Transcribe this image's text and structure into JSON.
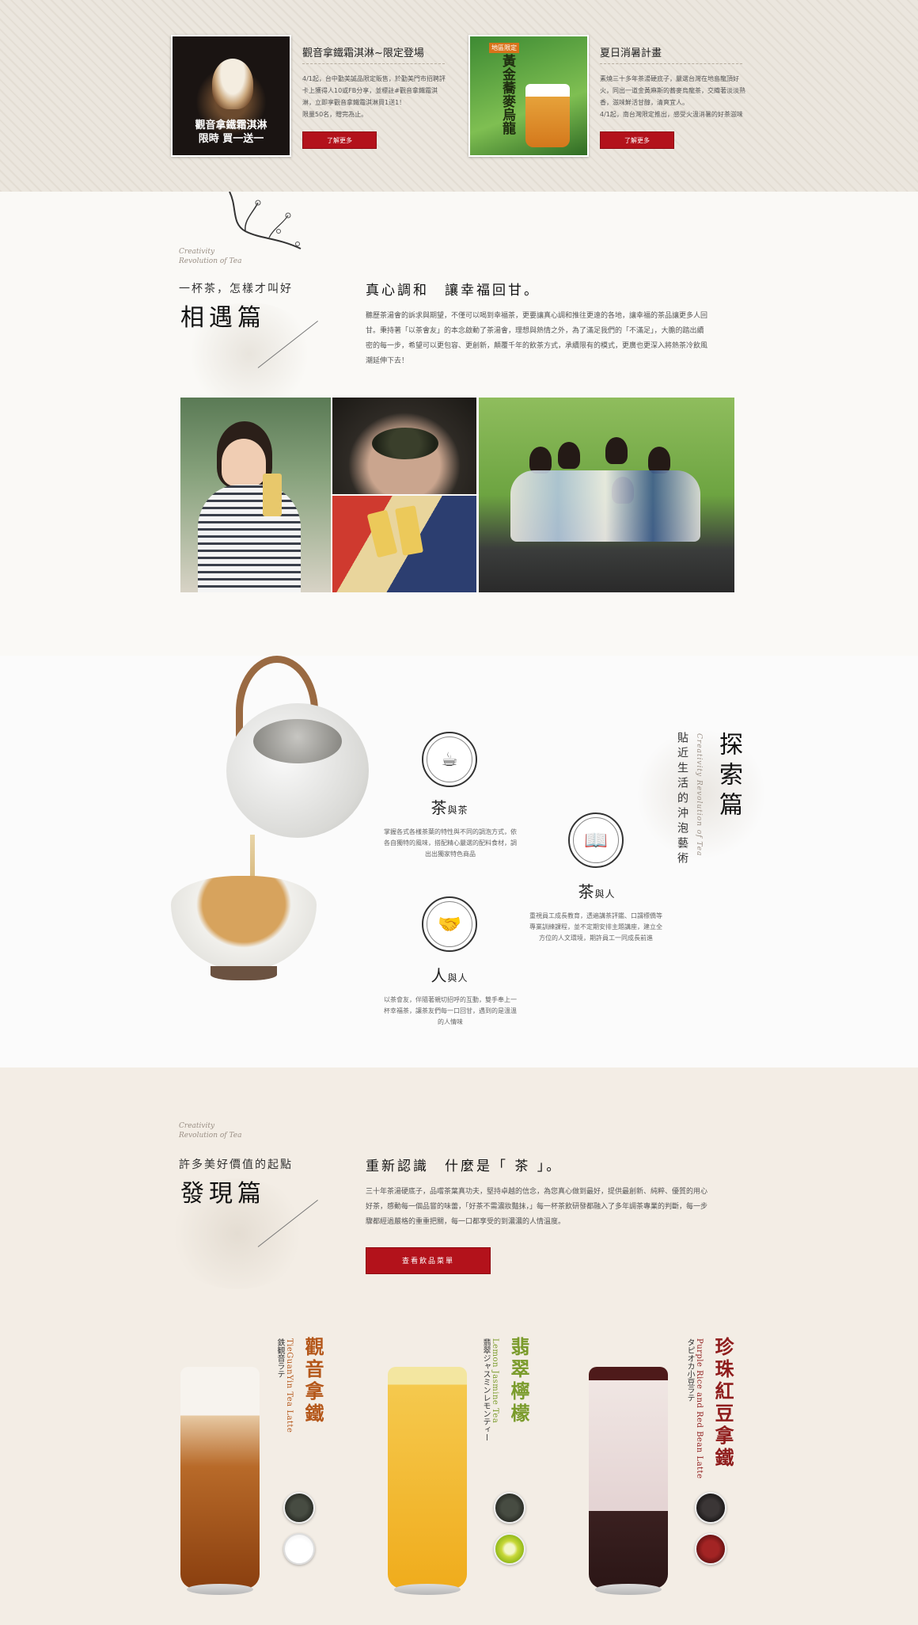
{
  "news": [
    {
      "title": "觀音拿鐵霜淇淋~限定登場",
      "thumb_caption": "觀音拿鐵霜淇淋\n限時 買一送一",
      "desc": "4/1起，台中勤美誠品限定販售，於勤美門市招聘評卡上獲得人10或FB分享，並標註#觀音拿鐵霜淇淋，立即享觀音拿鐵霜淇淋買1送1！\n限量50名，贈完為止。",
      "button": "了解更多"
    },
    {
      "title": "夏日消暑計畫",
      "thumb_caption": "黃金蕎麥烏龍",
      "thumb_badge": "地區限定",
      "desc": "素燒三十多年茶湯硬底子，嚴選台灣在地島龍頂好火，同出一道金黃麻斯的蕎麥烏龍茶，交織著淡淡熟香，滋味鮮活甘醇，清爽宜人。\n4/1起，南台灣限定推出，感受火溫消暑的好茶滋味",
      "button": "了解更多"
    }
  ],
  "encounter": {
    "en_tag": "Creativity\nRevolution of Tea",
    "subtitle": "一杯茶，怎樣才叫好",
    "title": "相遇篇",
    "headline": "真心調和　讓幸福回甘。",
    "body": "聽歷茶湯會的訴求與期望，不僅可以喝到幸福茶，更要讓真心調和推往更遠的各地，讓幸福的茶品讓更多人回甘。秉持著「以茶會友」的本念啟動了茶湯會，理想與熱情之外，為了滿足我們的「不滿足」，大膽的踏出續密的每一步，希望可以更包容、更創新，顛覆千年的飲茶方式，承續限有的模式，更廣也更深入將熱茶冷飲風潮延伸下去！"
  },
  "explore": {
    "en_tag": "Creativity Revolution of Tea",
    "subtitle": "貼近生活的沖泡藝術",
    "title": "探索篇",
    "items": [
      {
        "icon": "teapot-icon",
        "title_main": "茶",
        "title_small": "與",
        "title_end": "茶",
        "desc": "掌握各式各樣茶葉的特性與不同的調泡方式，依各自獨特的風味，搭配精心嚴選的配料食材，調出出獨家特色商品"
      },
      {
        "icon": "book-icon",
        "title_main": "茶",
        "title_small": "與",
        "title_end": "人",
        "desc": "重視員工成長教育，透遍講茶評鑑、口謂標僑等專業訓練課程，並不定期安排主題講座，建立全方位的人文環境，期許員工一同成長前進"
      },
      {
        "icon": "handshake-icon",
        "title_main": "人",
        "title_small": "與",
        "title_end": "人",
        "desc": "以茶會友，伴隨著親切招呼的互動，雙手奉上一杯幸福茶，讓茶友們每一口回甘，遇到的是溫溫的人情味"
      }
    ]
  },
  "discover": {
    "en_tag": "Creativity\nRevolution of Tea",
    "subtitle": "許多美好價值的起點",
    "title": "發現篇",
    "headline": "重新認識　什麼是「 茶 」。",
    "body": "三十年茶湯硬底子，品嚐茶葉真功夫，堅持卓越的信念，為您真心做到最好，提供最創新、純粹、優質的用心好茶，感動每一個品嘗的味蕾，「好茶不需濃妝豔抹，」每一杯茶飲研發都融入了多年調茶專業的判斷，每一步驟都經過嚴格的重重把關，每一口都享受的到濃濃的人情溫度。",
    "button": "查看飲品菜單",
    "drinks": [
      {
        "name_cn": "觀音拿鐵",
        "name_en": "TieGuanYin Tea Latte",
        "name_jp": "鉄観音ラテ",
        "color": "#b4571a"
      },
      {
        "name_cn": "翡翠檸檬",
        "name_en": "Lemon Jasmine Tea",
        "name_jp": "翡翠ジャスミンレモンティー",
        "color": "#7a9b2b"
      },
      {
        "name_cn": "珍珠紅豆拿鐵",
        "name_en": "Purple Rice and Red Bean Latte",
        "name_jp": "タピオカ小豆ラテ",
        "color": "#8f1c1c"
      }
    ]
  },
  "colors": {
    "accent_red": "#b3121b",
    "beige": "#f3ede5"
  }
}
